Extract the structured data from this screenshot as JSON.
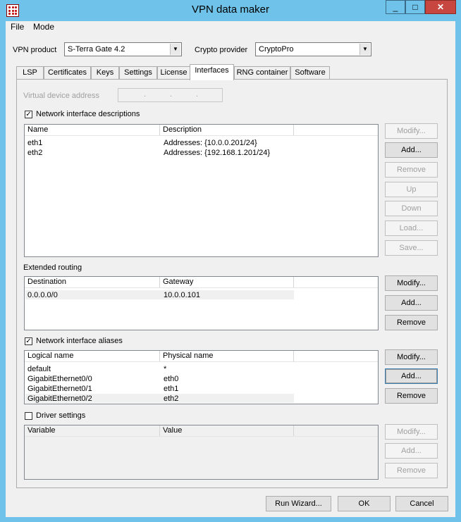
{
  "window": {
    "title": "VPN data maker",
    "minimize_label": "_",
    "maximize_label": "□",
    "close_label": "✕"
  },
  "menu": {
    "file": "File",
    "mode": "Mode"
  },
  "top": {
    "vpn_product_label": "VPN product",
    "vpn_product_value": "S-Terra Gate 4.2",
    "crypto_provider_label": "Crypto provider",
    "crypto_provider_value": "CryptoPro"
  },
  "tabs": [
    {
      "label": "LSP",
      "active": false
    },
    {
      "label": "Certificates",
      "active": false
    },
    {
      "label": "Keys",
      "active": false
    },
    {
      "label": "Settings",
      "active": false
    },
    {
      "label": "License",
      "active": false
    },
    {
      "label": "Interfaces",
      "active": true
    },
    {
      "label": "RNG container",
      "active": false
    },
    {
      "label": "Software",
      "active": false
    }
  ],
  "virtual_device": {
    "label": "Virtual device address",
    "dots": [
      ".",
      ".",
      "."
    ]
  },
  "nid": {
    "checkbox_label": "Network interface descriptions",
    "checked": true,
    "columns": [
      "Name",
      "Description"
    ],
    "rows": [
      {
        "name": "eth1",
        "description": "Addresses: {10.0.0.201/24}"
      },
      {
        "name": "eth2",
        "description": "Addresses: {192.168.1.201/24}"
      }
    ],
    "buttons": {
      "modify": "Modify...",
      "add": "Add...",
      "remove": "Remove",
      "up": "Up",
      "down": "Down",
      "load": "Load...",
      "save": "Save..."
    }
  },
  "routing": {
    "label": "Extended routing",
    "columns": [
      "Destination",
      "Gateway"
    ],
    "rows": [
      {
        "destination": "0.0.0.0/0",
        "gateway": "10.0.0.101"
      }
    ],
    "buttons": {
      "modify": "Modify...",
      "add": "Add...",
      "remove": "Remove"
    }
  },
  "aliases": {
    "checkbox_label": "Network interface aliases",
    "checked": true,
    "columns": [
      "Logical name",
      "Physical name"
    ],
    "rows": [
      {
        "logical": "default",
        "physical": "*"
      },
      {
        "logical": "GigabitEthernet0/0",
        "physical": "eth0"
      },
      {
        "logical": "GigabitEthernet0/1",
        "physical": "eth1"
      },
      {
        "logical": "GigabitEthernet0/2",
        "physical": "eth2"
      }
    ],
    "buttons": {
      "modify": "Modify...",
      "add": "Add...",
      "remove": "Remove"
    }
  },
  "driver": {
    "checkbox_label": "Driver settings",
    "checked": false,
    "columns": [
      "Variable",
      "Value"
    ],
    "buttons": {
      "modify": "Modify...",
      "add": "Add...",
      "remove": "Remove"
    }
  },
  "footer": {
    "run_wizard": "Run Wizard...",
    "ok": "OK",
    "cancel": "Cancel"
  }
}
